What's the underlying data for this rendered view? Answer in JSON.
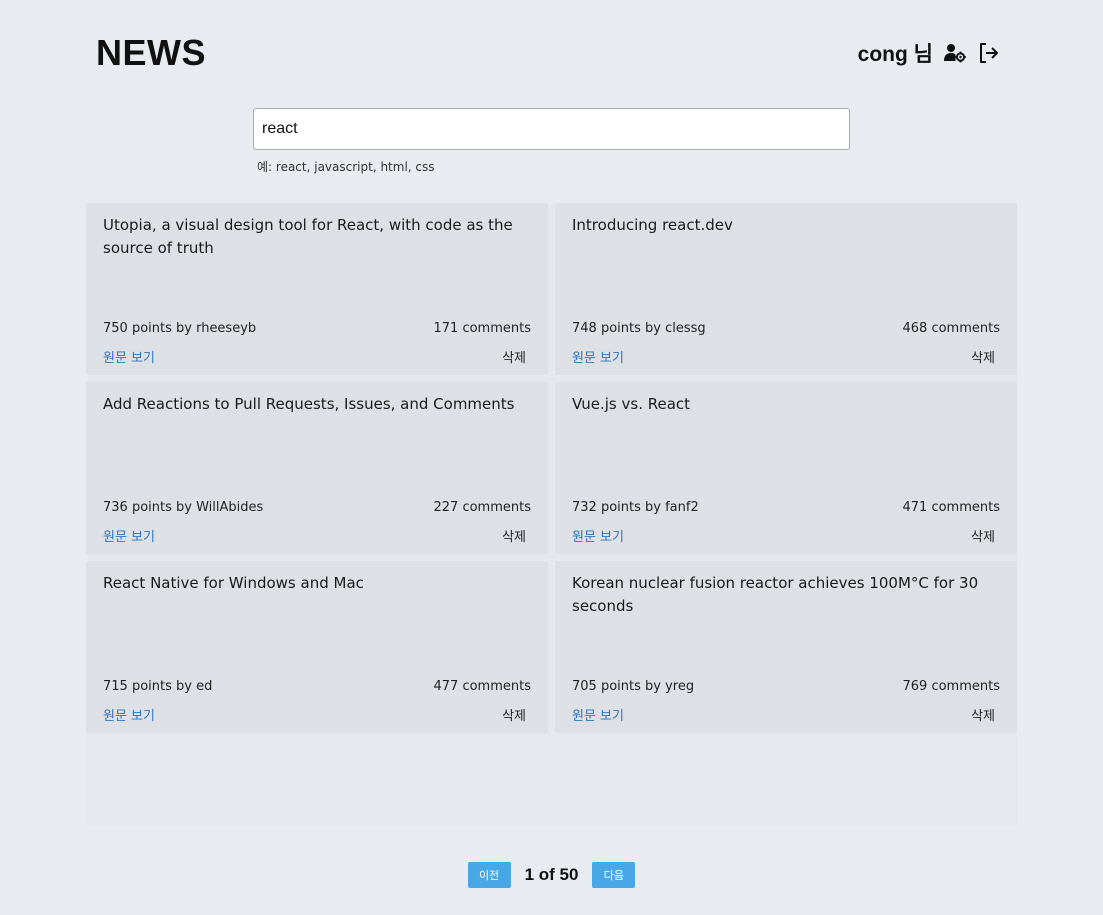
{
  "header": {
    "logo": "NEWS",
    "username": "cong 님",
    "icons": [
      "user-settings-icon",
      "logout-icon"
    ]
  },
  "search": {
    "value": "react",
    "hint": "예: react, javascript, html, css"
  },
  "articles": [
    {
      "title": "Utopia, a visual design tool for React, with code as the source of truth",
      "points_by": "750 points by rheeseyb",
      "comments": "171 comments",
      "view_label": "원문 보기",
      "delete_label": "삭제"
    },
    {
      "title": "Introducing react.dev",
      "points_by": "748 points by clessg",
      "comments": "468 comments",
      "view_label": "원문 보기",
      "delete_label": "삭제"
    },
    {
      "title": "Add Reactions to Pull Requests, Issues, and Comments",
      "points_by": "736 points by WillAbides",
      "comments": "227 comments",
      "view_label": "원문 보기",
      "delete_label": "삭제"
    },
    {
      "title": "Vue.js vs. React",
      "points_by": "732 points by fanf2",
      "comments": "471 comments",
      "view_label": "원문 보기",
      "delete_label": "삭제"
    },
    {
      "title": "React Native for Windows and Mac",
      "points_by": "715 points by ed",
      "comments": "477 comments",
      "view_label": "원문 보기",
      "delete_label": "삭제"
    },
    {
      "title": "Korean nuclear fusion reactor achieves 100M°C for 30 seconds",
      "points_by": "705 points by yreg",
      "comments": "769 comments",
      "view_label": "원문 보기",
      "delete_label": "삭제"
    }
  ],
  "pagination": {
    "prev_label": "이전",
    "page_info": "1 of 50",
    "next_label": "다음"
  },
  "colors": {
    "background": "#e8ebef",
    "card": "#dde0e5",
    "link": "#2f74c0",
    "button": "#47a8e5"
  }
}
